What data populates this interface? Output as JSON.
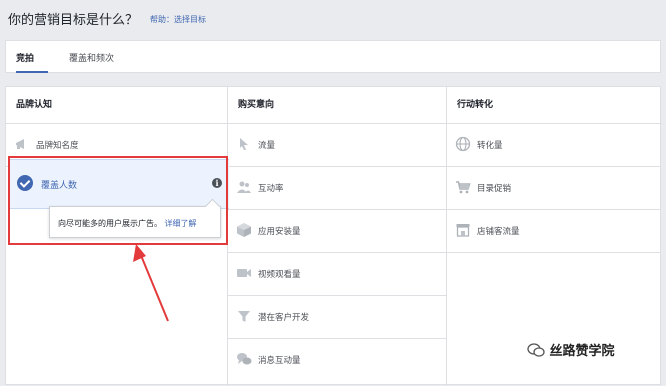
{
  "header": {
    "title": "你的营销目标是什么？",
    "help_label": "帮助：选择目标"
  },
  "tabs": [
    {
      "label": "竞拍",
      "active": true
    },
    {
      "label": "覆盖和频次",
      "active": false
    }
  ],
  "columns": [
    {
      "title": "品牌认知"
    },
    {
      "title": "购买意向"
    },
    {
      "title": "行动转化"
    }
  ],
  "awareness": [
    {
      "label": "品牌知名度",
      "icon": "megaphone-icon"
    },
    {
      "label": "覆盖人数",
      "icon": "check-circle-icon",
      "selected": true
    }
  ],
  "consideration": [
    {
      "label": "流量",
      "icon": "cursor-icon"
    },
    {
      "label": "互动率",
      "icon": "people-icon"
    },
    {
      "label": "应用安装量",
      "icon": "box-icon"
    },
    {
      "label": "视频观看量",
      "icon": "video-camera-icon"
    },
    {
      "label": "潜在客户开发",
      "icon": "funnel-icon"
    },
    {
      "label": "消息互动量",
      "icon": "chat-bubbles-icon"
    }
  ],
  "conversion": [
    {
      "label": "转化量",
      "icon": "globe-icon"
    },
    {
      "label": "目录促销",
      "icon": "cart-icon"
    },
    {
      "label": "店铺客流量",
      "icon": "store-icon"
    }
  ],
  "tooltip": {
    "text": "向尽可能多的用户展示广告。",
    "link": "详细了解"
  },
  "info_icon": "i",
  "watermark": "丝路赞学院",
  "colors": {
    "accent": "#4267b2",
    "highlight_box": "#e33b3b",
    "selected_bg": "#ecf3ff"
  }
}
